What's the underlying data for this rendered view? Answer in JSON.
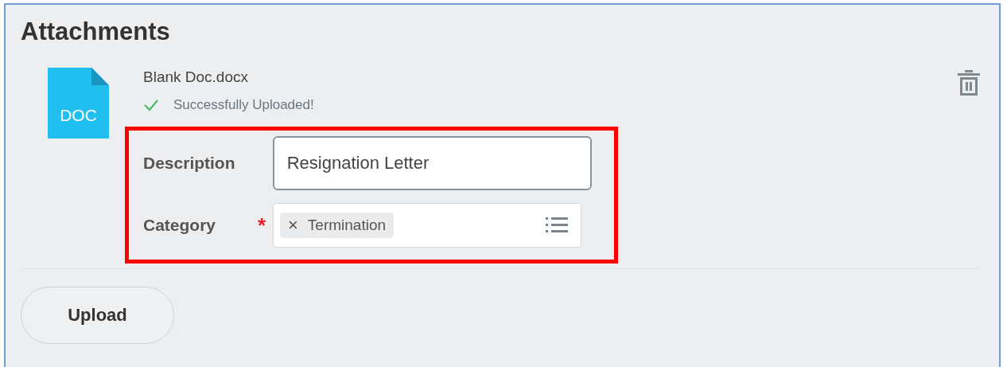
{
  "title": "Attachments",
  "file": {
    "icon_label": "DOC",
    "name": "Blank Doc.docx",
    "status": "Successfully Uploaded!",
    "uploaded": true
  },
  "form": {
    "highlighted": true,
    "description": {
      "label": "Description",
      "value": "Resignation Letter"
    },
    "category": {
      "label": "Category",
      "required": true,
      "required_mark": "*",
      "tags": [
        {
          "remove": "×",
          "label": "Termination"
        }
      ]
    }
  },
  "buttons": [
    {
      "label": "Upload"
    }
  ]
}
